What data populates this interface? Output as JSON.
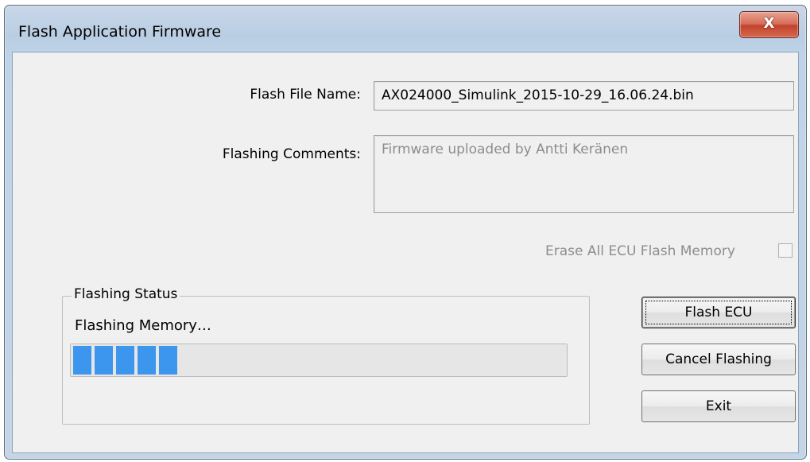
{
  "window": {
    "title": "Flash Application Firmware",
    "close_label": "X"
  },
  "form": {
    "flash_file_label": "Flash File Name:",
    "flash_file_value": "AX024000_Simulink_2015-10-29_16.06.24.bin",
    "comments_label": "Flashing Comments:",
    "comments_value": "Firmware uploaded by Antti Keränen",
    "erase_label": "Erase All ECU Flash Memory",
    "erase_checked": false
  },
  "status": {
    "group_title": "Flashing Status",
    "message": "Flashing Memory…",
    "progress_fraction": 0.22
  },
  "buttons": {
    "flash": "Flash ECU",
    "cancel": "Cancel Flashing",
    "exit": "Exit"
  }
}
